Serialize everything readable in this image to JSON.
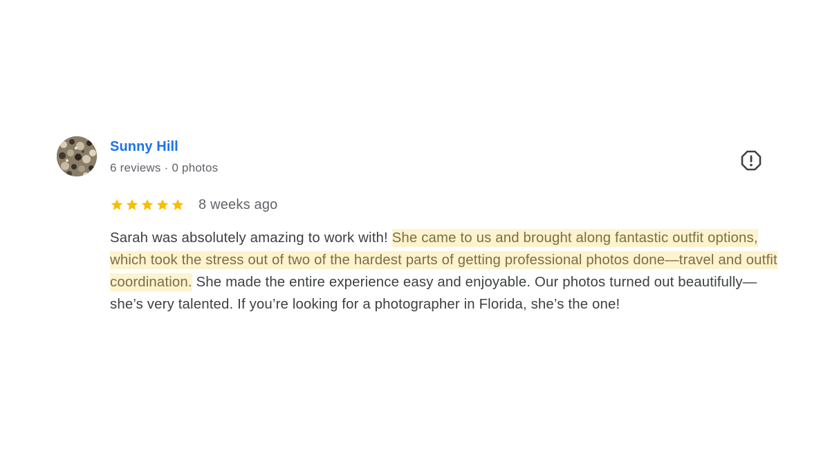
{
  "review": {
    "author_name": "Sunny Hill",
    "reviews_count": "6 reviews",
    "separator": "·",
    "photos_count": "0 photos",
    "rating": 5,
    "rating_max": 5,
    "date": "8 weeks ago",
    "text_before": "Sarah was absolutely amazing to work with! ",
    "text_highlight": "She came to us and brought along fantastic outfit options, which took the stress out of two of the hardest parts of getting professional photos done—travel and outfit coordination.",
    "text_after": " She made the entire experience easy and enjoyable. Our photos turned out beautifully—she’s very talented. If you’re looking for a photographer in Florida, she’s the one!"
  },
  "icons": {
    "avatar": "avatar-photo",
    "flag": "report-flag-icon",
    "star": "star-icon"
  },
  "colors": {
    "author_link": "#1a73e8",
    "star": "#fbbc04",
    "highlight_bg": "#fdf3cf",
    "highlight_text": "#7b6e44",
    "body_text": "#3c4043",
    "meta_text": "#5f6368"
  }
}
